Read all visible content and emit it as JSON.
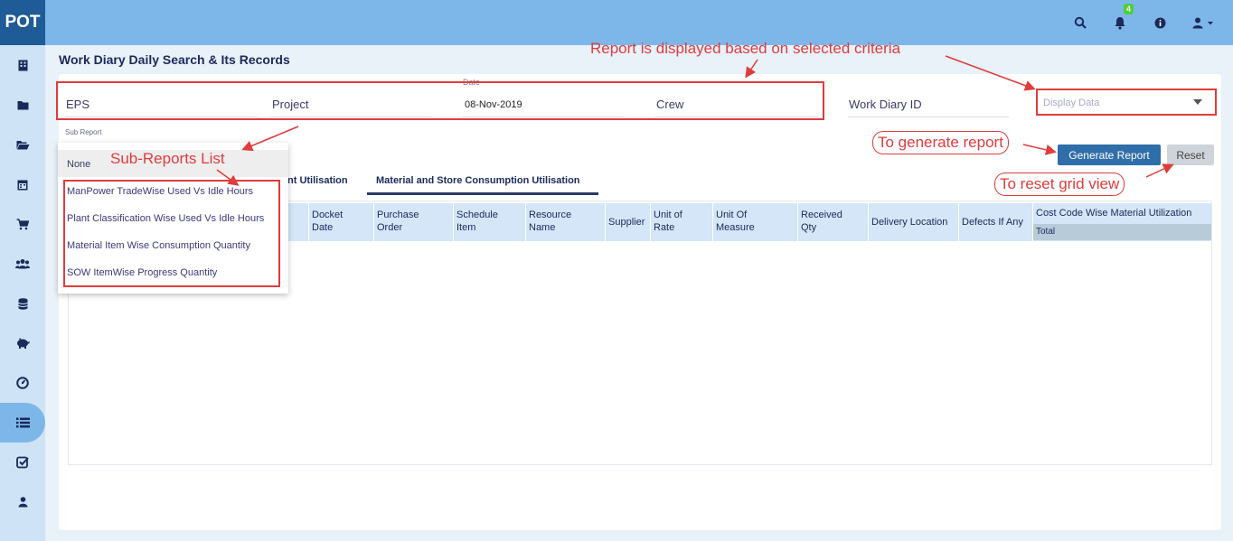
{
  "app": {
    "logo": "POT"
  },
  "topbar": {
    "icons": [
      "search-icon",
      "bell-icon",
      "info-icon",
      "user-icon"
    ],
    "notification_count": "4"
  },
  "sidebar": {
    "icons": [
      "building-icon",
      "folder-icon",
      "folder-open-icon",
      "calendar-icon",
      "cart-icon",
      "users-icon",
      "database-icon",
      "piggy-bank-icon",
      "dashboard-icon",
      "list-icon",
      "check-square-icon",
      "user-icon"
    ],
    "active_index": 9
  },
  "page": {
    "title": "Work Diary Daily Search & Its Records"
  },
  "filters": {
    "eps": "EPS",
    "project": "Project",
    "date_label": "Date",
    "date_value": "08-Nov-2019",
    "crew": "Crew",
    "work_diary_id": "Work Diary ID",
    "display_placeholder": "Display Data"
  },
  "buttons": {
    "generate": "Generate Report",
    "reset": "Reset"
  },
  "tabs": {
    "partial": "nt Utilisation",
    "active": "Material and Store Consumption Utilisation"
  },
  "grid": {
    "columns": [
      [
        "Docket",
        "Date"
      ],
      [
        "Purchase",
        "Order"
      ],
      [
        "Schedule",
        "Item"
      ],
      [
        "Resource",
        "Name"
      ],
      [
        "Supplier"
      ],
      [
        "Unit of",
        "Rate"
      ],
      [
        "Unit Of",
        "Measure"
      ],
      [
        "Received",
        "Qty"
      ],
      [
        "Delivery Location"
      ],
      [
        "Defects If Any"
      ]
    ],
    "group_header": "Cost Code Wise Material Utilization",
    "group_sub": "Total"
  },
  "sub_report": {
    "label": "Sub Report",
    "none": "None",
    "items": [
      "ManPower TradeWise Used Vs Idle Hours",
      "Plant Classification Wise Used Vs Idle Hours",
      "Material Item Wise Consumption Quantity",
      "SOW ItemWise Progress Quantity"
    ]
  },
  "annotations": {
    "report_displayed": "Report is displayed based on selected criteria",
    "sub_reports_list": "Sub-Reports List",
    "generate_note": "To generate report",
    "reset_note": "To reset grid view"
  },
  "colors": {
    "topbar": "#7db7e9",
    "sidebar": "#cfe3f6",
    "accent": "#2f6ea9",
    "annotation": "#e03c3c"
  }
}
